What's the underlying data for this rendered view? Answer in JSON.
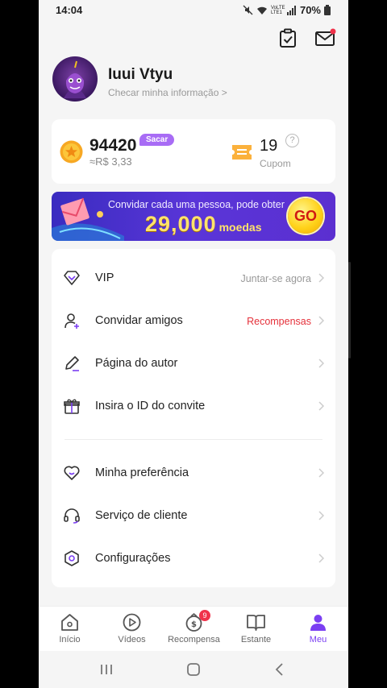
{
  "status_bar": {
    "time": "14:04",
    "network": "VoLTE LTE1",
    "battery": "70%"
  },
  "header": {
    "tasks_icon": "clipboard-check-icon",
    "messages_icon": "mail-icon"
  },
  "profile": {
    "name": "Iuui Vtyu",
    "link": "Checar minha informação >"
  },
  "wallet": {
    "coins": "94420",
    "withdraw_label": "Sacar",
    "coin_value": "≈R$ 3,33",
    "coupons": "19",
    "coupon_help": "?",
    "coupon_label": "Cupom"
  },
  "banner": {
    "line1": "Convidar cada uma pessoa, pode obter",
    "amount": "29,000",
    "unit": "moedas",
    "go_label": "GO"
  },
  "menu": {
    "vip": {
      "label": "VIP",
      "right": "Juntar-se agora"
    },
    "invite": {
      "label": "Convidar amigos",
      "right": "Recompensas"
    },
    "author": {
      "label": "Página do autor"
    },
    "invite_id": {
      "label": "Insira o ID do convite"
    },
    "preference": {
      "label": "Minha preferência"
    },
    "support": {
      "label": "Serviço de cliente"
    },
    "settings": {
      "label": "Configurações"
    }
  },
  "bottom_nav": {
    "home": "Início",
    "videos": "Vídeos",
    "rewards": "Recompensa",
    "rewards_badge": "9",
    "library": "Estante",
    "me": "Meu"
  },
  "colors": {
    "accent": "#7b3ff2",
    "red": "#e5303a",
    "gold": "#ffd21a"
  }
}
